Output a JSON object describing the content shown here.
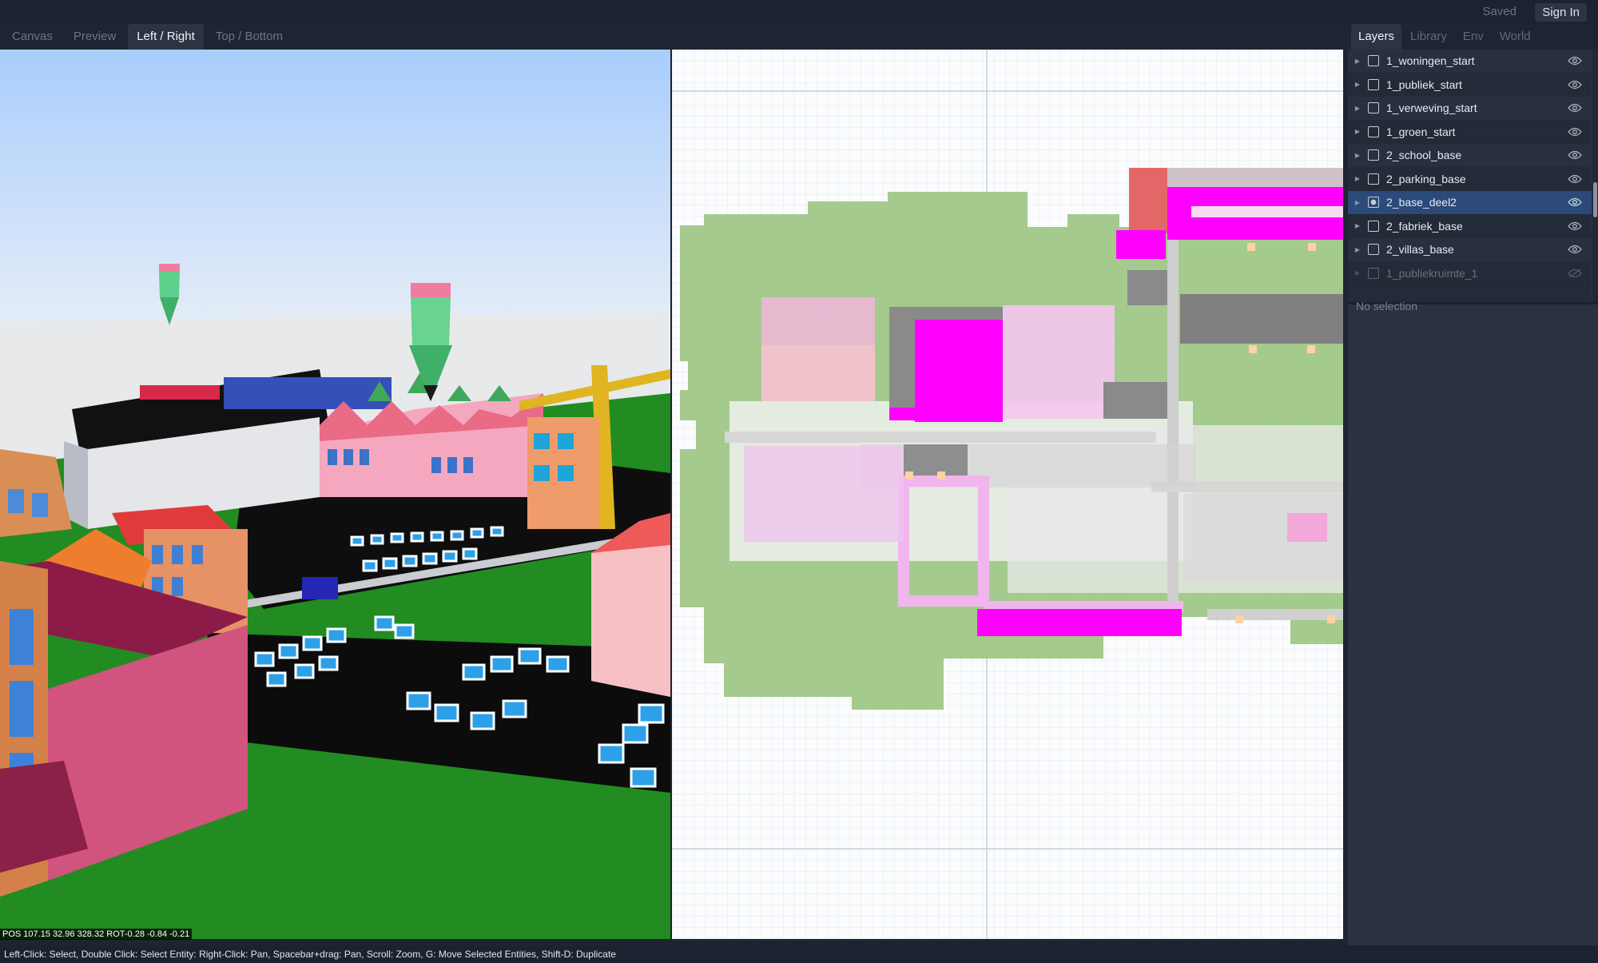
{
  "topbar": {
    "saved_label": "Saved",
    "signin_label": "Sign In"
  },
  "view_tabs": [
    {
      "label": "Canvas",
      "active": false
    },
    {
      "label": "Preview",
      "active": false
    },
    {
      "label": "Left / Right",
      "active": true
    },
    {
      "label": "Top / Bottom",
      "active": false
    }
  ],
  "panel_tabs": [
    {
      "label": "Layers",
      "active": true
    },
    {
      "label": "Library",
      "active": false
    },
    {
      "label": "Env",
      "active": false
    },
    {
      "label": "World",
      "active": false
    }
  ],
  "layers": [
    {
      "name": "1_woningen_start",
      "selected": false,
      "visible": true
    },
    {
      "name": "1_publiek_start",
      "selected": false,
      "visible": true
    },
    {
      "name": "1_verweving_start",
      "selected": false,
      "visible": true
    },
    {
      "name": "1_groen_start",
      "selected": false,
      "visible": true
    },
    {
      "name": "2_school_base",
      "selected": false,
      "visible": true
    },
    {
      "name": "2_parking_base",
      "selected": false,
      "visible": true
    },
    {
      "name": "2_base_deel2",
      "selected": true,
      "visible": true
    },
    {
      "name": "2_fabriek_base",
      "selected": false,
      "visible": true
    },
    {
      "name": "2_villas_base",
      "selected": false,
      "visible": true
    },
    {
      "name": "1_publiekruimte_1",
      "selected": false,
      "visible": false
    }
  ],
  "inspector": {
    "empty_label": "No selection"
  },
  "viewport": {
    "pos_readout": "POS 107.15 32.96 328.32 ROT-0.28 -0.84 -0.21"
  },
  "statusbar": {
    "hint": "Left-Click: Select, Double Click: Select Entity: Right-Click: Pan, Spacebar+drag: Pan, Scroll: Zoom, G: Move Selected Entities, Shift-D: Duplicate"
  },
  "colors": {
    "accent": "#2b4a7a",
    "panel": "#2a3140",
    "magenta": "#ff00ff",
    "green_zone": "#9bc482",
    "background": "#1e2532"
  }
}
